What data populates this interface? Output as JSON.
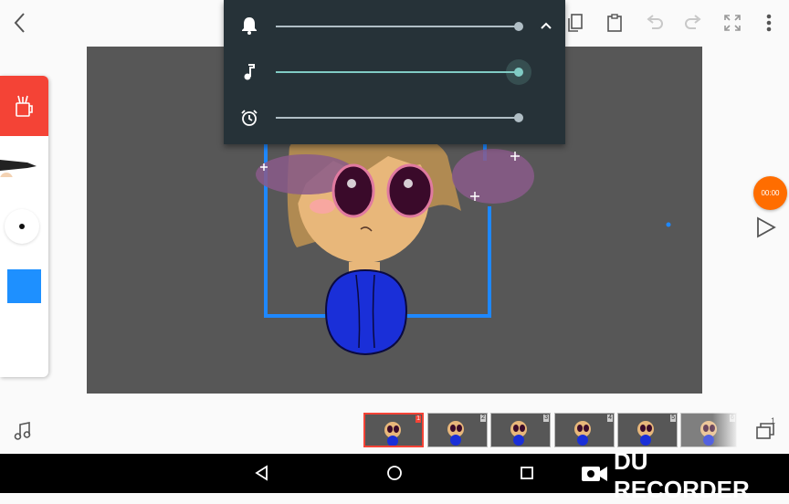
{
  "toolbar": {
    "icons": [
      "back-arrow-icon",
      "copy-icon",
      "paste-icon",
      "undo-icon",
      "redo-icon",
      "fullscreen-icon",
      "more-vert-icon"
    ]
  },
  "volume_panel": {
    "rows": [
      {
        "icon": "bell-icon",
        "level": 0.95
      },
      {
        "icon": "music-note-icon",
        "level": 0.95
      },
      {
        "icon": "alarm-icon",
        "level": 0.95
      }
    ],
    "accent": "#80cbc4"
  },
  "tool_panel": {
    "selected_color": "#1e90ff",
    "header_color": "#f44336"
  },
  "timer": {
    "label": "00:00",
    "color": "#ff6d00"
  },
  "timeline": {
    "frames": [
      {
        "number": "1",
        "selected": true
      },
      {
        "number": "2",
        "selected": false
      },
      {
        "number": "3",
        "selected": false
      },
      {
        "number": "4",
        "selected": false
      },
      {
        "number": "5",
        "selected": false
      },
      {
        "number": "6",
        "selected": false
      }
    ],
    "layers_badge": "1"
  },
  "watermark": {
    "text": "DU RECORDER"
  }
}
